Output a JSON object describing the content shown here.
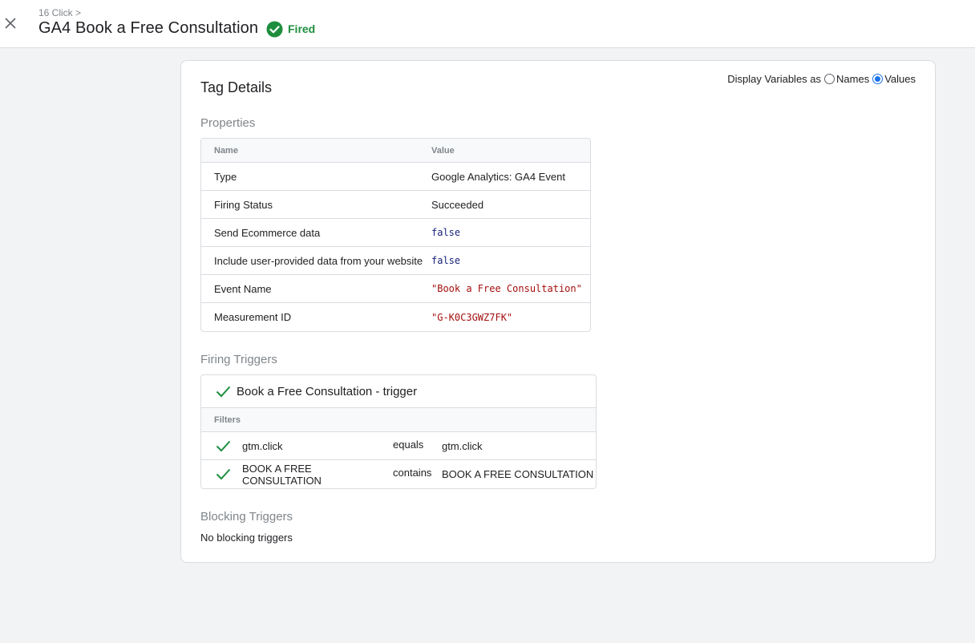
{
  "header": {
    "breadcrumb": "16 Click >",
    "title": "GA4 Book a Free Consultation",
    "status": "Fired",
    "status_color": "#1e8e3e",
    "close_icon": "close-icon",
    "status_icon": "check-circle-icon"
  },
  "card": {
    "title": "Tag Details",
    "display_vars": {
      "label": "Display Variables as",
      "options": [
        "Names",
        "Values"
      ],
      "selected": "Values"
    }
  },
  "properties": {
    "section_title": "Properties",
    "columns": [
      "Name",
      "Value"
    ],
    "rows": [
      {
        "name": "Type",
        "value": "Google Analytics: GA4 Event"
      },
      {
        "name": "Firing Status",
        "value": "Succeeded"
      },
      {
        "name": "Send Ecommerce data",
        "value": "false"
      },
      {
        "name": "Include user-provided data from your website",
        "value": "false"
      },
      {
        "name": "Event Name",
        "value": "\"Book a Free Consultation\""
      },
      {
        "name": "Measurement ID",
        "value": "\"G-K0C3GWZ7FK\""
      }
    ]
  },
  "firing_triggers": {
    "section_title": "Firing Triggers",
    "trigger_name": "Book a Free Consultation - trigger",
    "filters_label": "Filters",
    "filters": [
      {
        "variable": "gtm.click",
        "operator": "equals",
        "value": "gtm.click"
      },
      {
        "variable": "BOOK A FREE CONSULTATION",
        "operator": "contains",
        "value": "BOOK A FREE CONSULTATION"
      }
    ]
  },
  "blocking_triggers": {
    "section_title": "Blocking Triggers",
    "empty_text": "No blocking triggers"
  }
}
